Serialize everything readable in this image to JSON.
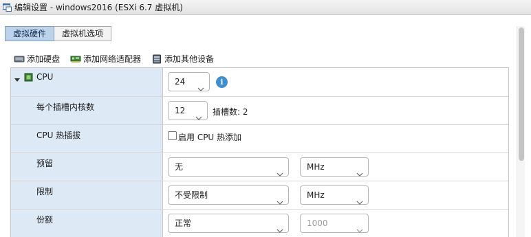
{
  "window": {
    "title": "编辑设置 - windows2016 (ESXi 6.7 虚拟机)"
  },
  "tabs": [
    {
      "label": "虚拟硬件",
      "active": true
    },
    {
      "label": "虚拟机选项",
      "active": false
    }
  ],
  "toolbar": {
    "add_disk": "添加硬盘",
    "add_nic": "添加网络适配器",
    "add_other": "添加其他设备"
  },
  "cpu": {
    "label": "CPU",
    "count": "24",
    "cores_label": "每个插槽内核数",
    "cores": "12",
    "sockets_text": "插槽数: 2",
    "hotplug_label": "CPU 热插拔",
    "hotplug_checkbox_label": "启用 CPU 热添加",
    "hotplug_enabled": false,
    "reservation_label": "预留",
    "reservation_value": "无",
    "reservation_unit": "MHz",
    "limit_label": "限制",
    "limit_value": "不受限制",
    "limit_unit": "MHz",
    "shares_label": "份额",
    "shares_value": "正常",
    "shares_number": "1000"
  },
  "colors": {
    "label_bg": "#dde9f5",
    "tab_active": "#bcd3ec",
    "info": "#3d8fd4"
  }
}
